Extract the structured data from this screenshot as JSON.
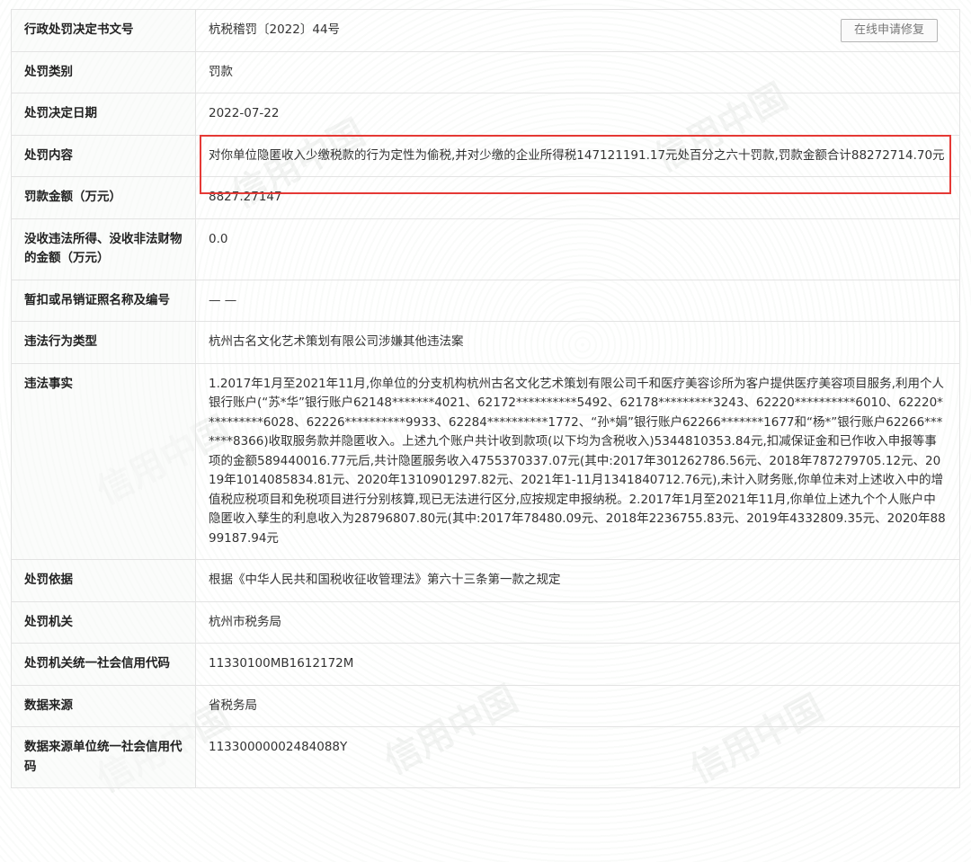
{
  "actions": {
    "online_repair_label": "在线申请修复"
  },
  "watermark": {
    "text": "信用中国",
    "color": "#8c968c"
  },
  "highlight": {
    "color": "#e53935"
  },
  "rows": [
    {
      "label": "行政处罚决定书文号",
      "value": "杭税稽罚〔2022〕44号"
    },
    {
      "label": "处罚类别",
      "value": "罚款"
    },
    {
      "label": "处罚决定日期",
      "value": "2022-07-22"
    },
    {
      "label": "处罚内容",
      "value": "对你单位隐匿收入少缴税款的行为定性为偷税,并对少缴的企业所得税147121191.17元处百分之六十罚款,罚款金额合计88272714.70元"
    },
    {
      "label": "罚款金额（万元）",
      "value": "8827.27147"
    },
    {
      "label": "没收违法所得、没收非法财物的金额（万元）",
      "value": "0.0"
    },
    {
      "label": "暂扣或吊销证照名称及编号",
      "value": "— —"
    },
    {
      "label": "违法行为类型",
      "value": "杭州古名文化艺术策划有限公司涉嫌其他违法案"
    },
    {
      "label": "违法事实",
      "value": "1.2017年1月至2021年11月,你单位的分支机构杭州古名文化艺术策划有限公司千和医疗美容诊所为客户提供医疗美容项目服务,利用个人银行账户(“苏*华”银行账户62148*******4021、62172**********5492、62178*********3243、62220**********6010、62220**********6028、62226**********9933、62284**********1772、“孙*娟”银行账户62266*******1677和“杨*”银行账户62266*******8366)收取服务款并隐匿收入。上述九个账户共计收到款项(以下均为含税收入)5344810353.84元,扣减保证金和已作收入申报等事项的金额589440016.77元后,共计隐匿服务收入4755370337.07元(其中:2017年301262786.56元、2018年787279705.12元、2019年1014085834.81元、2020年1310901297.82元、2021年1-11月1341840712.76元),未计入财务账,你单位未对上述收入中的增值税应税项目和免税项目进行分别核算,现已无法进行区分,应按规定申报纳税。2.2017年1月至2021年11月,你单位上述九个个人账户中隐匿收入孳生的利息收入为28796807.80元(其中:2017年78480.09元、2018年2236755.83元、2019年4332809.35元、2020年8899187.94元"
    },
    {
      "label": "处罚依据",
      "value": "根据《中华人民共和国税收征收管理法》第六十三条第一款之规定"
    },
    {
      "label": "处罚机关",
      "value": "杭州市税务局"
    },
    {
      "label": "处罚机关统一社会信用代码",
      "value": "11330100MB1612172M"
    },
    {
      "label": "数据来源",
      "value": "省税务局"
    },
    {
      "label": "数据来源单位统一社会信用代码",
      "value": "11330000002484088Y"
    }
  ]
}
